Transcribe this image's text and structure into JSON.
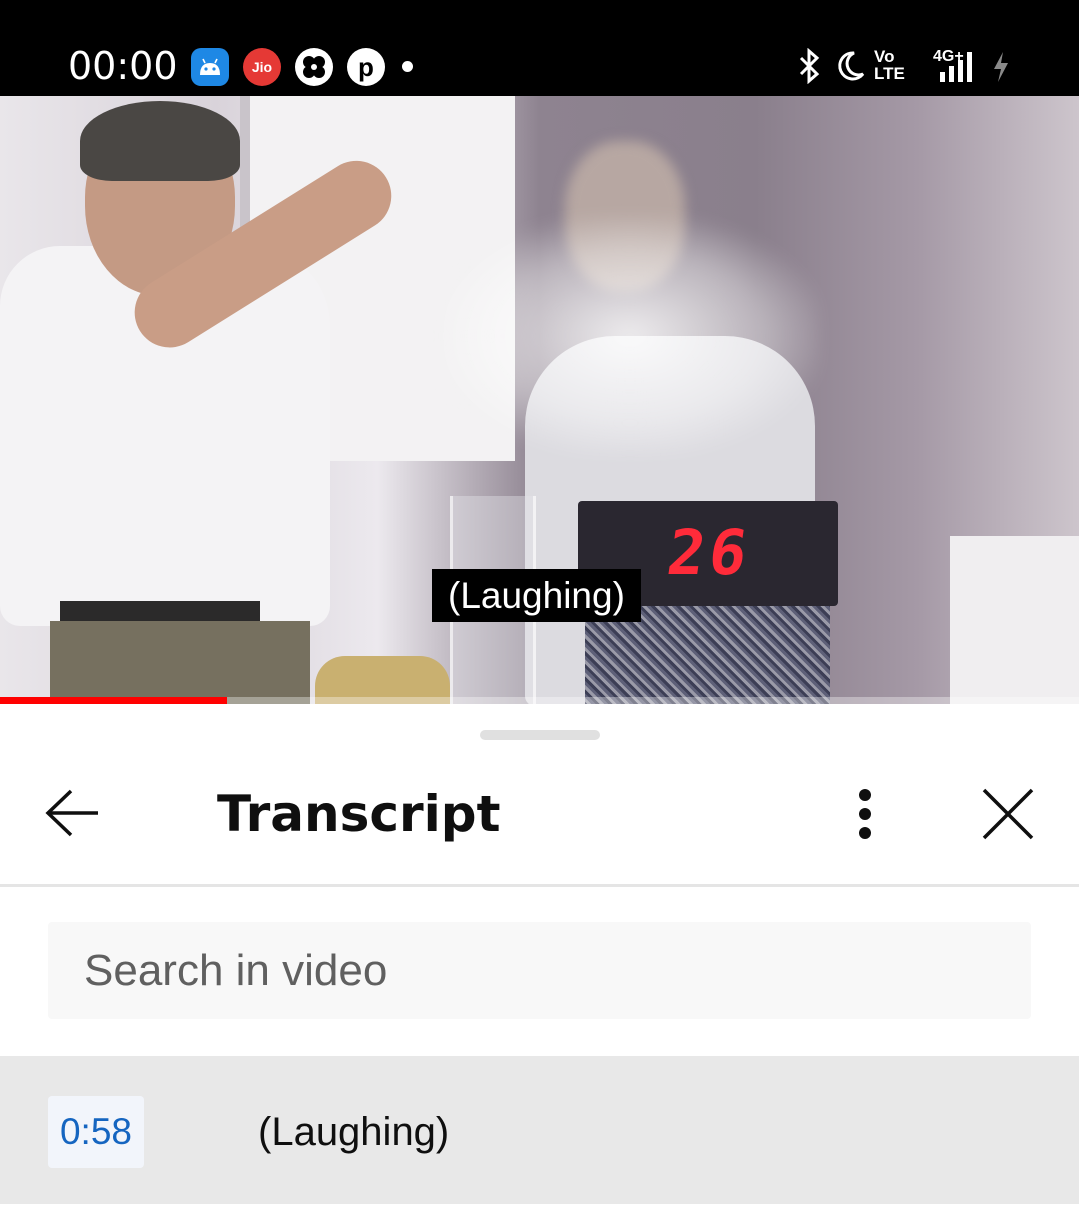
{
  "status_bar": {
    "time": "00:00",
    "jio_label": "Jio",
    "pin_label": "p",
    "volte_label": "Vo\nLTE",
    "network_label": "4G+",
    "icons": [
      "android-app-icon",
      "jio-icon",
      "fan-app-icon",
      "pinterest-icon",
      "notification-dot",
      "bluetooth-icon",
      "do-not-disturb-moon-icon",
      "volte-icon",
      "signal-4g-icon",
      "battery-charging-icon"
    ]
  },
  "video": {
    "caption": "(Laughing)",
    "counter_value": "26",
    "progress_fraction": 0.21,
    "progress_color": "#ff0000"
  },
  "transcript_panel": {
    "title": "Transcript",
    "search_placeholder": "Search in video",
    "segments": [
      {
        "timestamp": "0:58",
        "text": "(Laughing)"
      }
    ],
    "accent_color": "#1565c0"
  }
}
